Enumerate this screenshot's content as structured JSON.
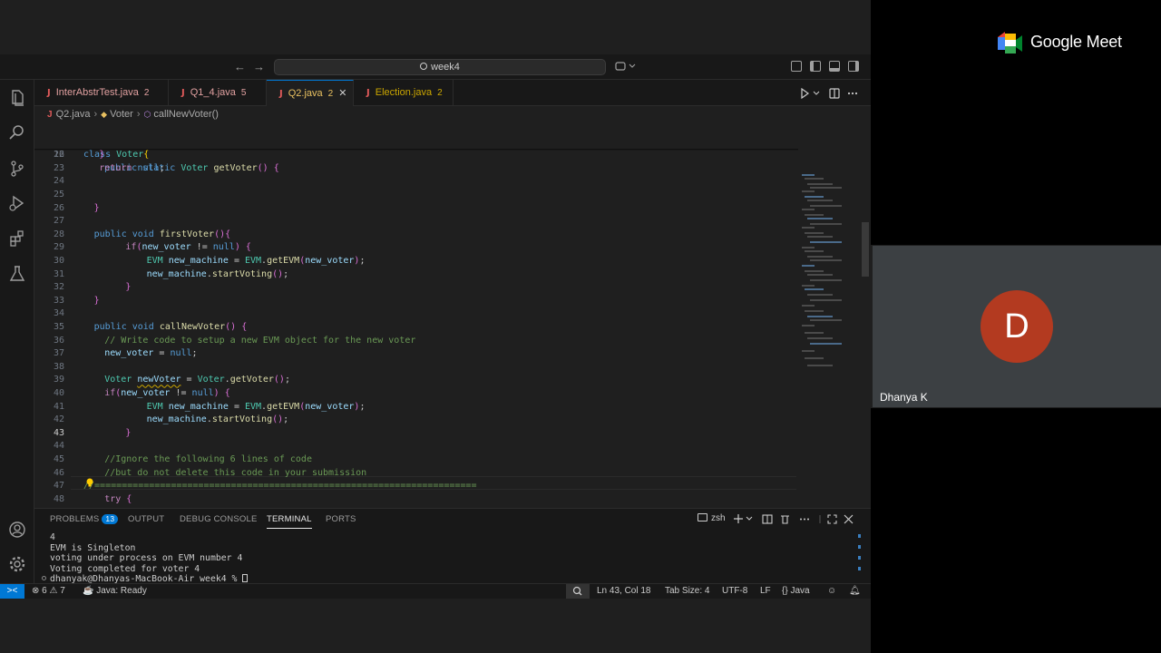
{
  "window": {
    "search_text": "week4",
    "nav_back": "←",
    "nav_forward": "→"
  },
  "tabs": [
    {
      "label": "InterAbstrTest.java",
      "count": "2"
    },
    {
      "label": "Q1_4.java",
      "count": "5"
    },
    {
      "label": "Q2.java",
      "count": "2",
      "close": "✕"
    },
    {
      "label": "Election.java",
      "count": "2"
    }
  ],
  "tab_icon": "J",
  "breadcrumb": {
    "file": "Q2.java",
    "class": "Voter",
    "method": "callNewVoter()",
    "sep": "›"
  },
  "editor": {
    "sticky": [
      {
        "num": "3",
        "code": "class Voter{"
      },
      {
        "num": "16",
        "code": "public static Voter getVoter() {"
      }
    ],
    "lines": [
      {
        "num": "22",
        "code": "}"
      },
      {
        "num": "23",
        "code": "return null;"
      },
      {
        "num": "24",
        "code": ""
      },
      {
        "num": "25",
        "code": ""
      },
      {
        "num": "26",
        "code": "}"
      },
      {
        "num": "27",
        "code": ""
      },
      {
        "num": "28",
        "code": "public void firstVoter(){"
      },
      {
        "num": "29",
        "code": "if(new_voter != null) {"
      },
      {
        "num": "30",
        "code": "EVM new_machine = EVM.getEVM(new_voter);"
      },
      {
        "num": "31",
        "code": "new_machine.startVoting();"
      },
      {
        "num": "32",
        "code": "}"
      },
      {
        "num": "33",
        "code": "}"
      },
      {
        "num": "34",
        "code": ""
      },
      {
        "num": "35",
        "code": "public void callNewVoter() {"
      },
      {
        "num": "36",
        "code": "// Write code to setup a new EVM object for the new voter"
      },
      {
        "num": "37",
        "code": "new_voter = null;"
      },
      {
        "num": "38",
        "code": ""
      },
      {
        "num": "39",
        "code": "Voter newVoter = Voter.getVoter();"
      },
      {
        "num": "40",
        "code": "if(new_voter != null) {"
      },
      {
        "num": "41",
        "code": "EVM new_machine = EVM.getEVM(new_voter);"
      },
      {
        "num": "42",
        "code": "new_machine.startVoting();"
      },
      {
        "num": "43",
        "code": "}"
      },
      {
        "num": "44",
        "code": ""
      },
      {
        "num": "45",
        "code": "//Ignore the following 6 lines of code"
      },
      {
        "num": "46",
        "code": "//but do not delete this code in your submission"
      },
      {
        "num": "47",
        "code": "//======================================================================"
      },
      {
        "num": "48",
        "code": "try {"
      }
    ]
  },
  "panel": {
    "tabs": [
      {
        "label": "PROBLEMS",
        "badge": "13"
      },
      {
        "label": "OUTPUT"
      },
      {
        "label": "DEBUG CONSOLE"
      },
      {
        "label": "TERMINAL"
      },
      {
        "label": "PORTS"
      }
    ],
    "shell": "zsh",
    "terminal_lines": [
      "4",
      "EVM is Singleton",
      "voting under process on EVM number 4",
      "Voting completed for voter 4",
      "dhanyak@Dhanyas-MacBook-Air week4 % "
    ]
  },
  "statusbar": {
    "remote": "><",
    "errors": "6",
    "warnings": "7",
    "java_status": "Java: Ready",
    "position": "Ln 43, Col 18",
    "tab_size": "Tab Size: 4",
    "encoding": "UTF-8",
    "eol": "LF",
    "language": "Java"
  },
  "meet": {
    "brand": "Google Meet",
    "participant_name": "Dhanya K",
    "avatar_letter": "D",
    "avatar_color": "#b33a20"
  },
  "colors": {
    "accent": "#0078d4",
    "editor_bg": "#1f1f1f",
    "keyword": "#569cd6",
    "type": "#4ec9b0",
    "function": "#dcdcaa",
    "comment": "#6a9955"
  }
}
